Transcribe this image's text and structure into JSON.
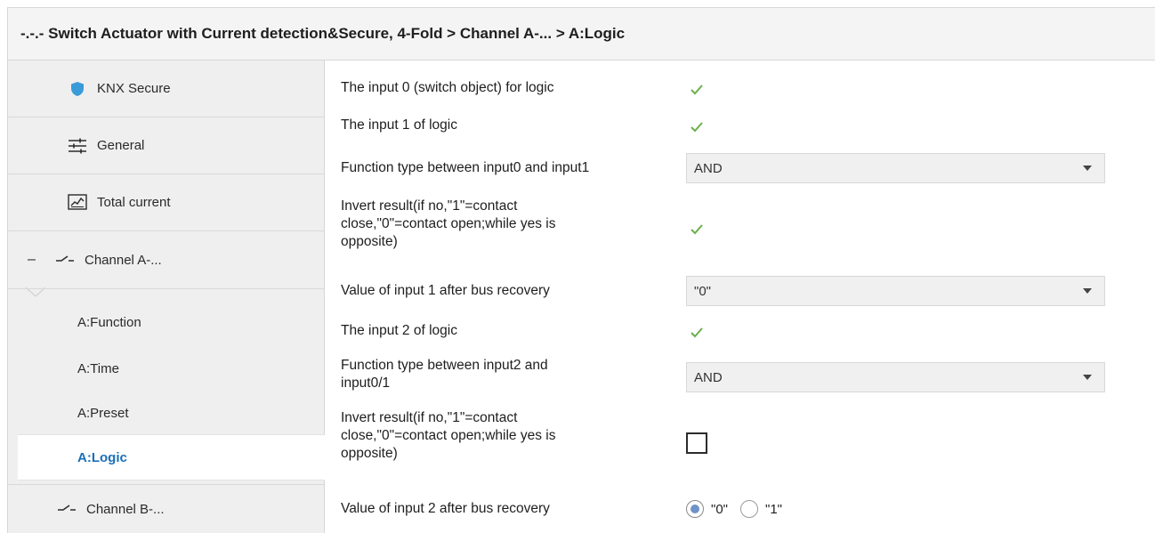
{
  "breadcrumb": "-.-.- Switch Actuator with Current detection&Secure, 4-Fold > Channel A-... >  A:Logic",
  "sidebar": {
    "items": [
      {
        "label": "KNX Secure",
        "icon": "shield-icon"
      },
      {
        "label": "General",
        "icon": "sliders-icon"
      },
      {
        "label": "Total current",
        "icon": "chart-icon"
      },
      {
        "label": "Channel A-...",
        "icon": "switch-icon",
        "collapse": "–"
      },
      {
        "label": "Channel B-...",
        "icon": "switch-icon"
      }
    ],
    "sub_items": [
      "A:Function",
      "A:Time",
      "A:Preset",
      "A:Logic"
    ],
    "active": "A:Logic"
  },
  "params": {
    "p1": {
      "label": "The input 0 (switch object) for logic",
      "checked": true
    },
    "p2": {
      "label": "The input 1 of logic",
      "checked": true
    },
    "p3": {
      "label": "Function type between input0 and input1",
      "value": "AND"
    },
    "p4": {
      "label_lines": [
        "Invert result(if no,\"1\"=contact",
        "close,\"0\"=contact open;while yes is",
        "opposite)"
      ],
      "checked": true
    },
    "p5": {
      "label": "Value of input 1 after bus recovery",
      "value": "\"0\""
    },
    "p6": {
      "label": "The input 2 of logic",
      "checked": true
    },
    "p7": {
      "label_lines": [
        "Function type between input2 and",
        "input0/1"
      ],
      "value": "AND"
    },
    "p8": {
      "label_lines": [
        "Invert result(if no,\"1\"=contact",
        "close,\"0\"=contact open;while yes is",
        "opposite)"
      ],
      "checked": false
    },
    "p9": {
      "label": "Value of input 2 after bus recovery",
      "options": [
        "\"0\"",
        "\"1\""
      ],
      "selected": "\"0\""
    }
  },
  "colors": {
    "check": "#6ab04c",
    "active_link": "#1a6fb8",
    "shield": "#3a9bd9",
    "radio_selected": "#6f93c9"
  }
}
